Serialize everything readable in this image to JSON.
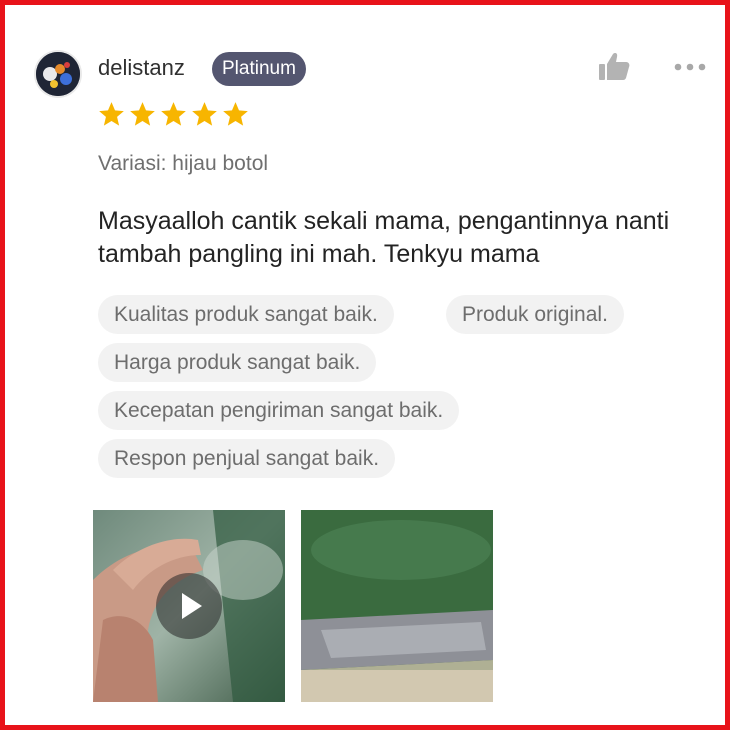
{
  "user": {
    "name": "delistanz",
    "badge": "Platinum"
  },
  "rating": {
    "stars": 5,
    "max": 5
  },
  "variant": "Variasi: hijau botol",
  "review_text": "Masyaalloh cantik sekali mama, pengantinnya nanti tambah pangling ini mah. Tenkyu mama",
  "tags": [
    "Kualitas produk sangat baik.",
    "Produk original.",
    "Harga produk sangat baik.",
    "Kecepatan pengiriman sangat baik.",
    "Respon penjual sangat baik."
  ],
  "media": [
    {
      "type": "video"
    },
    {
      "type": "image"
    }
  ],
  "colors": {
    "frame": "#e8131a",
    "badge": "#545670",
    "star": "#f7b500",
    "tag_bg": "#f2f2f2"
  },
  "icons": {
    "like": "thumbs-up-icon",
    "more": "more-dots-icon",
    "play": "play-icon"
  }
}
